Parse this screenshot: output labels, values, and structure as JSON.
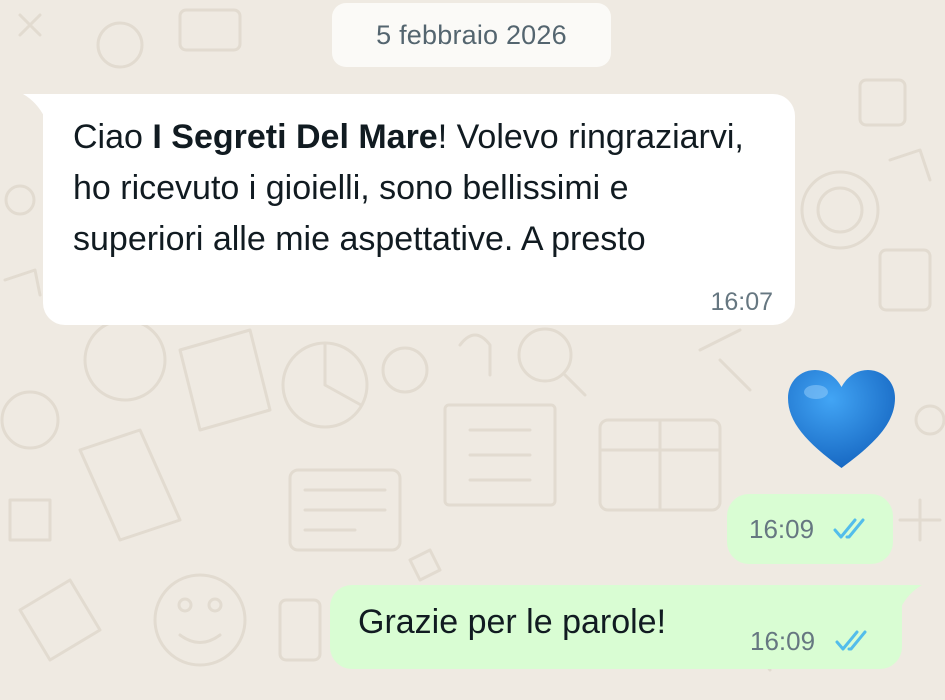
{
  "chat": {
    "date_separator": "5 febbraio 2026",
    "messages": [
      {
        "direction": "incoming",
        "text_before_bold": "Ciao ",
        "bold_text": "I Segreti Del Mare",
        "text_after_bold": "! Volevo ringraziarvi, ho ricevuto i gioielli, sono bellissimi e superiori alle mie aspettative. A presto",
        "time": "16:07"
      },
      {
        "direction": "outgoing",
        "emoji": "blue-heart-icon",
        "time": "16:09",
        "status": "read"
      },
      {
        "direction": "outgoing",
        "text": "Grazie per le parole!",
        "time": "16:09",
        "status": "read"
      }
    ]
  },
  "colors": {
    "wallpaper": "#efeae2",
    "incoming_bubble": "#ffffff",
    "outgoing_bubble": "#d9fdd3",
    "read_tick": "#53bdeb",
    "heart": "#1e88e5"
  }
}
